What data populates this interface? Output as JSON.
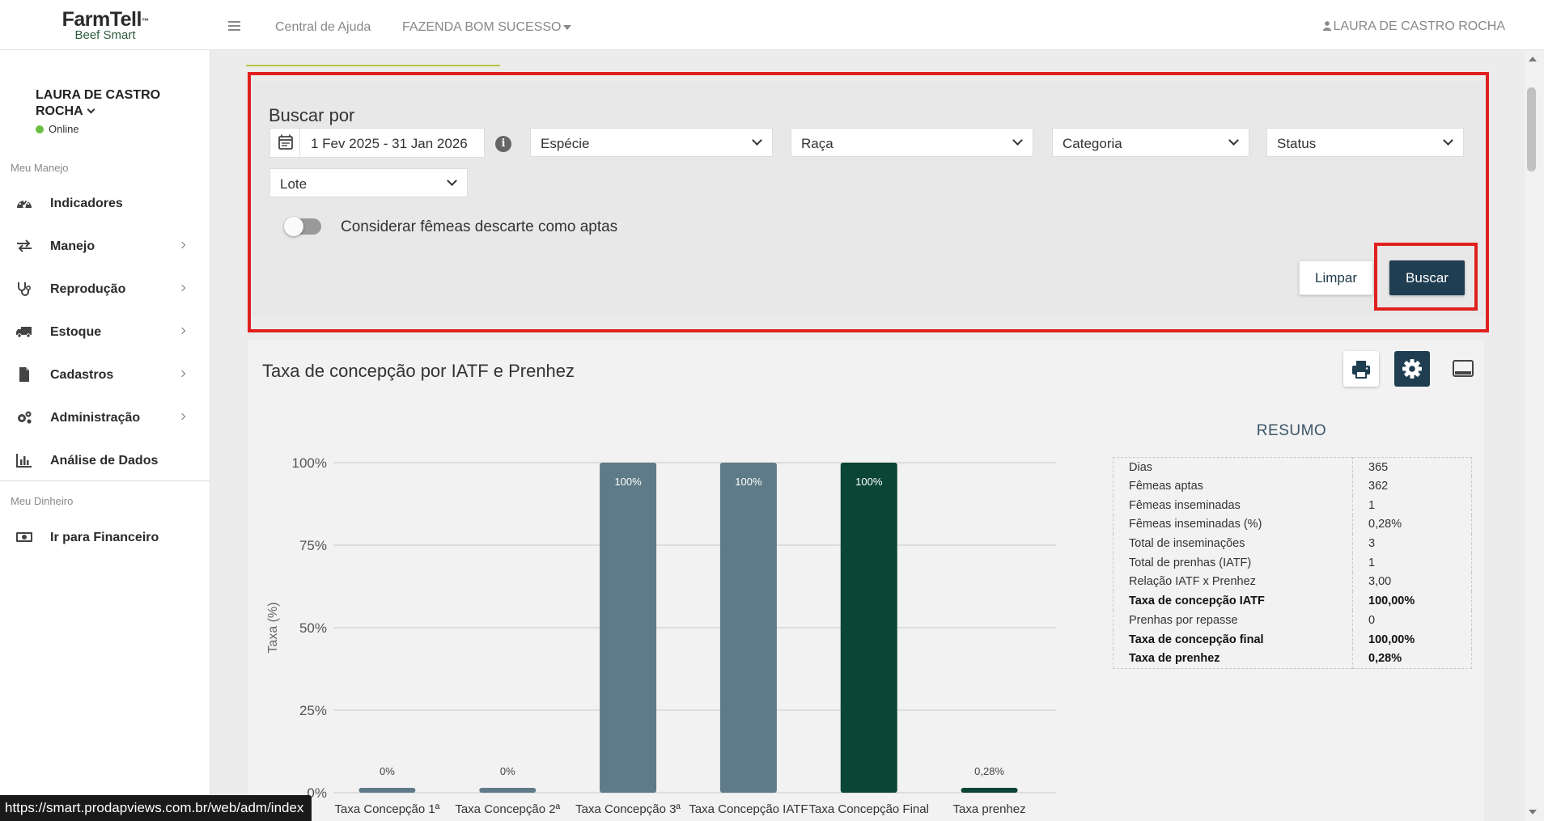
{
  "header": {
    "logo_brand": "FarmTell",
    "logo_tm": "™",
    "logo_sub": "Beef Smart",
    "help_link": "Central de Ajuda",
    "farm_selector": "FAZENDA BOM SUCESSO",
    "user": "LAURA DE CASTRO ROCHA"
  },
  "sidebar": {
    "user_name": "LAURA DE CASTRO ROCHA",
    "user_status": "Online",
    "section_manejo": "Meu Manejo",
    "section_dinheiro": "Meu Dinheiro",
    "items": [
      {
        "label": "Indicadores",
        "icon": "dashboard-icon",
        "has_submenu": false
      },
      {
        "label": "Manejo",
        "icon": "swap-arrows-icon",
        "has_submenu": true
      },
      {
        "label": "Reprodução",
        "icon": "stethoscope-icon",
        "has_submenu": true
      },
      {
        "label": "Estoque",
        "icon": "truck-icon",
        "has_submenu": true
      },
      {
        "label": "Cadastros",
        "icon": "file-icon",
        "has_submenu": true
      },
      {
        "label": "Administração",
        "icon": "gears-icon",
        "has_submenu": true
      },
      {
        "label": "Análise de Dados",
        "icon": "bar-chart-icon",
        "has_submenu": false
      }
    ],
    "finance_link": "Ir para Financeiro"
  },
  "filters": {
    "title": "Buscar por",
    "date_range": "1 Fev 2025 - 31 Jan 2026",
    "especie": "Espécie",
    "raca": "Raça",
    "categoria": "Categoria",
    "status": "Status",
    "lote": "Lote",
    "toggle_label": "Considerar fêmeas descarte como aptas",
    "toggle_on": false,
    "clear_button": "Limpar",
    "search_button": "Buscar"
  },
  "chart_panel": {
    "title": "Taxa de concepção por IATF e Prenhez"
  },
  "chart_data": {
    "type": "bar",
    "ylabel": "Taxa (%)",
    "ylim": [
      0,
      100
    ],
    "yticks": [
      "0%",
      "25%",
      "50%",
      "75%",
      "100%"
    ],
    "grid": true,
    "categories": [
      "Taxa Concepção 1ª",
      "Taxa Concepção 2ª",
      "Taxa Concepção 3ª",
      "Taxa Concepção IATF",
      "Taxa Concepção Final",
      "Taxa prenhez"
    ],
    "values": [
      0,
      0,
      100,
      100,
      100,
      0.28
    ],
    "data_labels": [
      "0%",
      "0%",
      "100%",
      "100%",
      "100%",
      "0,28%"
    ],
    "colors": [
      "#5f7b89",
      "#5f7b89",
      "#5f7b89",
      "#5f7b89",
      "#0a4536",
      "#0a4536"
    ]
  },
  "resumo": {
    "title": "RESUMO",
    "rows": [
      {
        "k": "Dias",
        "v": "365",
        "bold": false
      },
      {
        "k": "Fêmeas aptas",
        "v": "362",
        "bold": false
      },
      {
        "k": "Fêmeas inseminadas",
        "v": "1",
        "bold": false
      },
      {
        "k": "Fêmeas inseminadas (%)",
        "v": "0,28%",
        "bold": false
      },
      {
        "k": "Total de inseminações",
        "v": "3",
        "bold": false
      },
      {
        "k": "Total de prenhas (IATF)",
        "v": "1",
        "bold": false
      },
      {
        "k": "Relação IATF x Prenhez",
        "v": "3,00",
        "bold": false
      },
      {
        "k": "Taxa de concepção IATF",
        "v": "100,00%",
        "bold": true
      },
      {
        "k": "Prenhas por repasse",
        "v": "0",
        "bold": false
      },
      {
        "k": "Taxa de concepção final",
        "v": "100,00%",
        "bold": true
      },
      {
        "k": "Taxa de prenhez",
        "v": "0,28%",
        "bold": true
      }
    ]
  },
  "status_bar": {
    "url": "https://smart.prodapviews.com.br/web/adm/index"
  },
  "colors": {
    "highlight": "#e0201e",
    "primary_dark": "#1f3e52",
    "accent_line": "#b8c341",
    "online": "#6abf40"
  }
}
